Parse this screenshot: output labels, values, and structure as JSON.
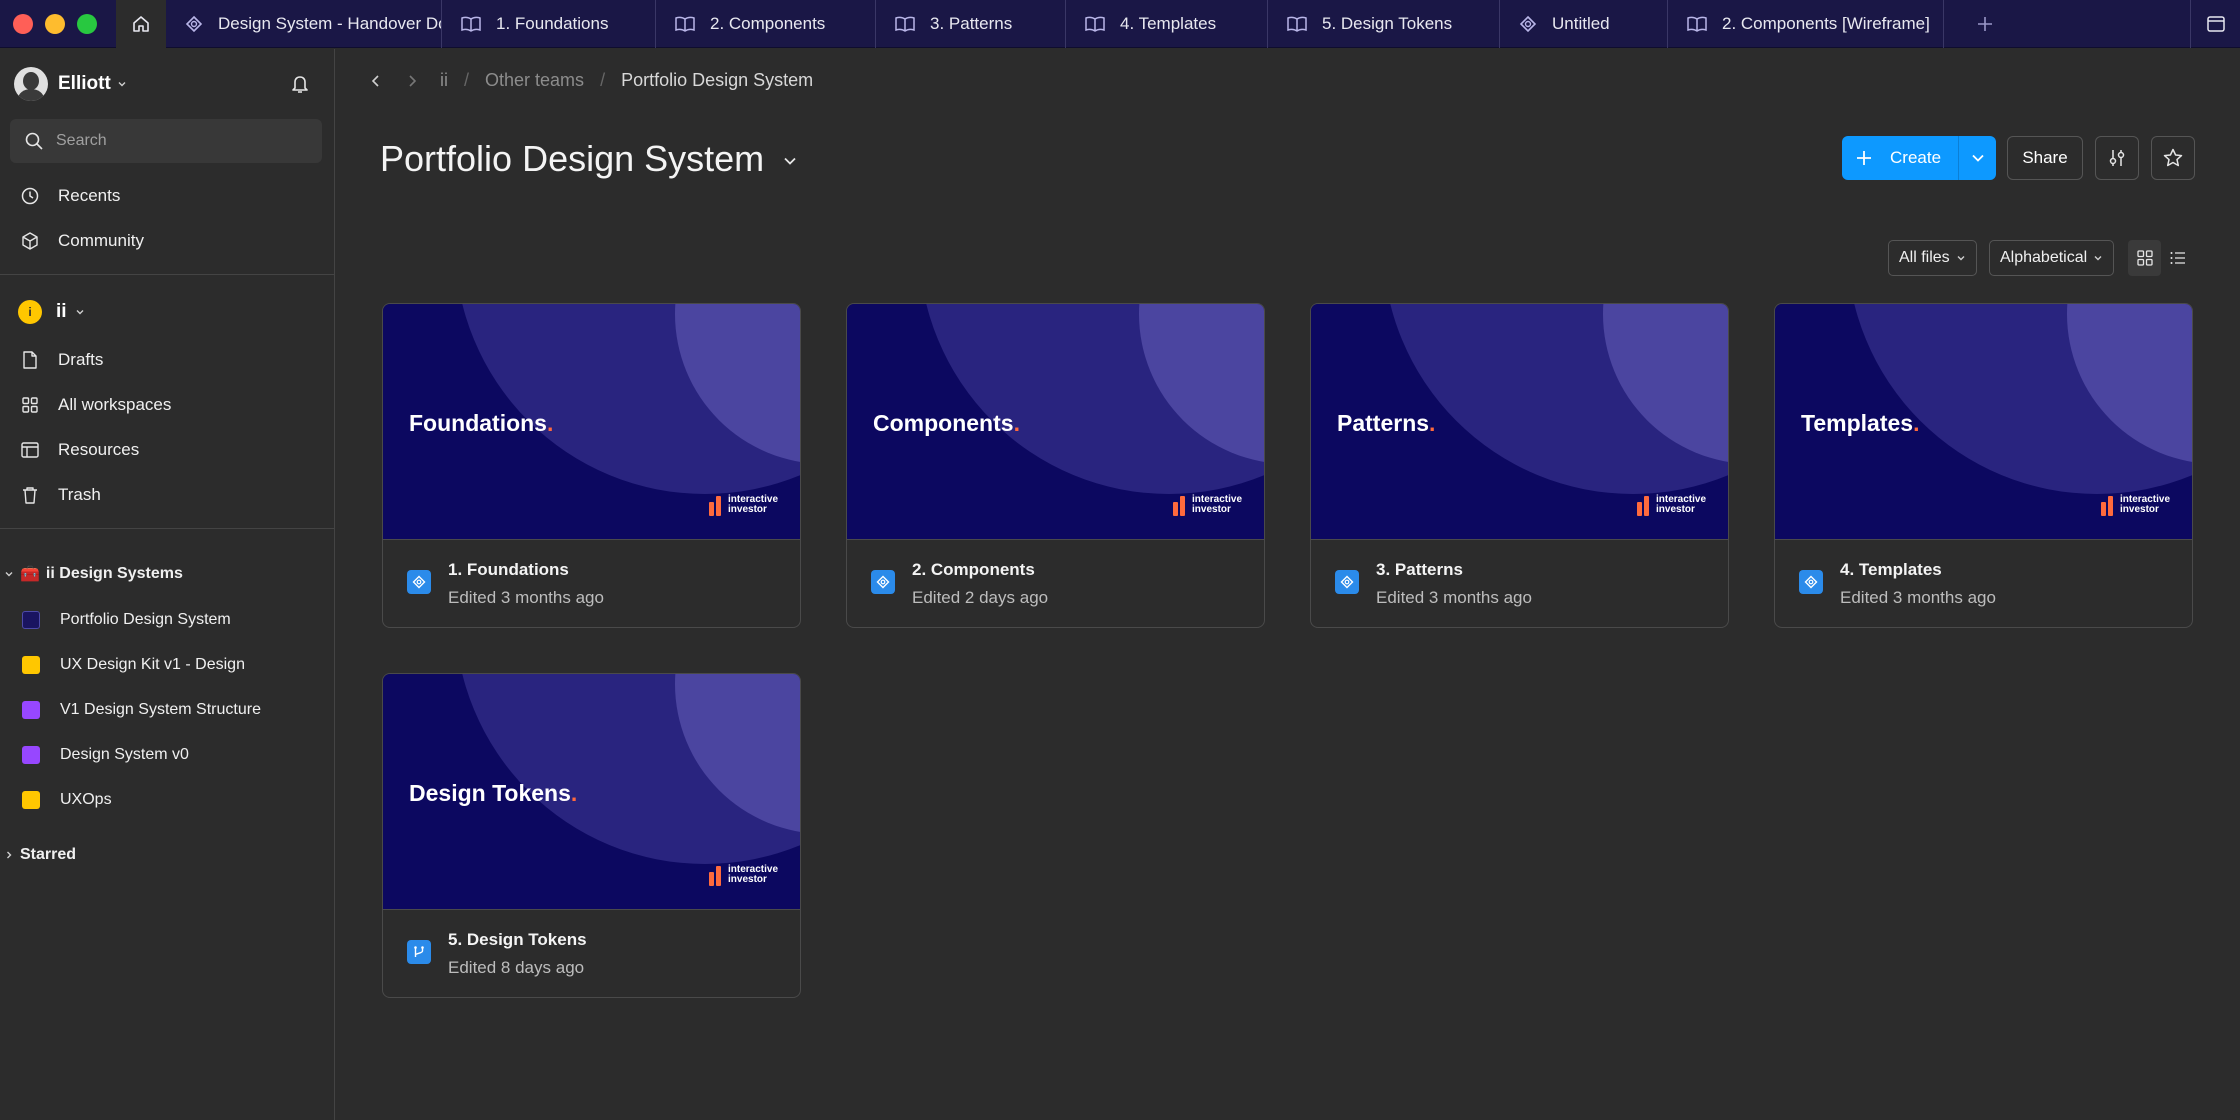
{
  "window": {
    "tabs": [
      {
        "label": "Design System - Handover Doc",
        "icon": "component-icon"
      },
      {
        "label": "1. Foundations",
        "icon": "book-icon"
      },
      {
        "label": "2. Components",
        "icon": "book-icon"
      },
      {
        "label": "3. Patterns",
        "icon": "book-icon"
      },
      {
        "label": "4. Templates",
        "icon": "book-icon"
      },
      {
        "label": "5. Design Tokens",
        "icon": "book-icon"
      },
      {
        "label": "Untitled",
        "icon": "component-icon"
      },
      {
        "label": "2. Components [Wireframe]",
        "icon": "book-icon"
      }
    ]
  },
  "sidebar": {
    "user": {
      "name": "Elliott"
    },
    "search": {
      "placeholder": "Search"
    },
    "primary": [
      {
        "label": "Recents",
        "icon": "clock-icon"
      },
      {
        "label": "Community",
        "icon": "community-icon"
      }
    ],
    "team": {
      "initial": "i",
      "name": "ii"
    },
    "workspace": [
      {
        "label": "Drafts",
        "icon": "file-icon"
      },
      {
        "label": "All workspaces",
        "icon": "grid-icon"
      },
      {
        "label": "Resources",
        "icon": "resources-icon"
      },
      {
        "label": "Trash",
        "icon": "trash-icon"
      }
    ],
    "group": {
      "emoji": "🧰",
      "label": "ii Design Systems"
    },
    "projects": [
      {
        "label": "Portfolio Design System",
        "color": "#1a1460"
      },
      {
        "label": "UX Design Kit v1 - Design",
        "color": "#ffc700"
      },
      {
        "label": "V1 Design System Structure",
        "color": "#9747ff"
      },
      {
        "label": "Design System v0",
        "color": "#9747ff"
      },
      {
        "label": "UXOps",
        "color": "#ffc700"
      }
    ],
    "starred": {
      "label": "Starred"
    }
  },
  "main": {
    "breadcrumb": [
      "ii",
      "Other teams",
      "Portfolio Design System"
    ],
    "title": "Portfolio Design System",
    "actions": {
      "create": "Create",
      "share": "Share"
    },
    "filters": {
      "files": "All files",
      "sort": "Alphabetical"
    },
    "files": [
      {
        "thumb_title": "Foundations",
        "name": "1. Foundations",
        "edited": "Edited 3 months ago",
        "icon": "component-icon"
      },
      {
        "thumb_title": "Components",
        "name": "2. Components",
        "edited": "Edited 2 days ago",
        "icon": "component-icon"
      },
      {
        "thumb_title": "Patterns",
        "name": "3. Patterns",
        "edited": "Edited 3 months ago",
        "icon": "component-icon"
      },
      {
        "thumb_title": "Templates",
        "name": "4. Templates",
        "edited": "Edited 3 months ago",
        "icon": "component-icon"
      },
      {
        "thumb_title": "Design Tokens",
        "name": "5. Design Tokens",
        "edited": "Edited 8 days ago",
        "icon": "branch-icon"
      }
    ],
    "logo": {
      "line1": "interactive",
      "line2": "investor",
      "accent": "#ff6a3d"
    }
  },
  "colors": {
    "tabbar": "#1a1746",
    "accent": "#0d99ff",
    "thumb": "#0c0860"
  }
}
